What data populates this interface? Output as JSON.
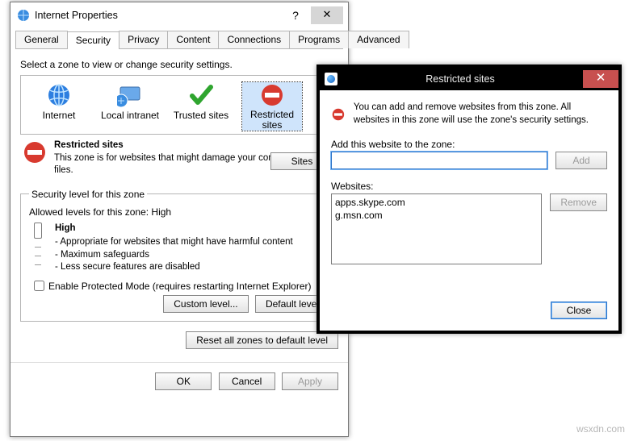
{
  "propWindow": {
    "title": "Internet Properties",
    "help": "?",
    "close": "✕"
  },
  "tabs": [
    {
      "label": "General"
    },
    {
      "label": "Security"
    },
    {
      "label": "Privacy"
    },
    {
      "label": "Content"
    },
    {
      "label": "Connections"
    },
    {
      "label": "Programs"
    },
    {
      "label": "Advanced"
    }
  ],
  "activeTab": 1,
  "selectZoneLabel": "Select a zone to view or change security settings.",
  "zones": [
    {
      "label": "Internet",
      "icon": "globe"
    },
    {
      "label": "Local intranet",
      "icon": "terminal"
    },
    {
      "label": "Trusted sites",
      "icon": "checkmark"
    },
    {
      "label": "Restricted sites",
      "icon": "no-entry"
    }
  ],
  "selectedZone": 3,
  "zoneInfo": {
    "title": "Restricted sites",
    "desc": "This zone is for websites that might damage your computer or your files."
  },
  "sitesBtn": "Sites",
  "secLevel": {
    "legend": "Security level for this zone",
    "allowed": "Allowed levels for this zone: High",
    "level": "High",
    "bullets": [
      "- Appropriate for websites that might have harmful content",
      "- Maximum safeguards",
      "- Less secure features are disabled"
    ]
  },
  "protectedMode": "Enable Protected Mode (requires restarting Internet Explorer)",
  "customLevelBtn": "Custom level...",
  "defaultLevelBtn": "Default level",
  "resetAllBtn": "Reset all zones to default level",
  "footer": {
    "ok": "OK",
    "cancel": "Cancel",
    "apply": "Apply"
  },
  "rsWindow": {
    "title": "Restricted sites",
    "close": "✕",
    "info": "You can add and remove websites from this zone. All websites in this zone will use the zone's security settings.",
    "addLbl": "Add this website to the zone:",
    "addBtn": "Add",
    "webLbl": "Websites:",
    "removeBtn": "Remove",
    "closeBtn": "Close",
    "sites": [
      "apps.skype.com",
      "g.msn.com"
    ]
  },
  "watermark": "wsxdn.com"
}
